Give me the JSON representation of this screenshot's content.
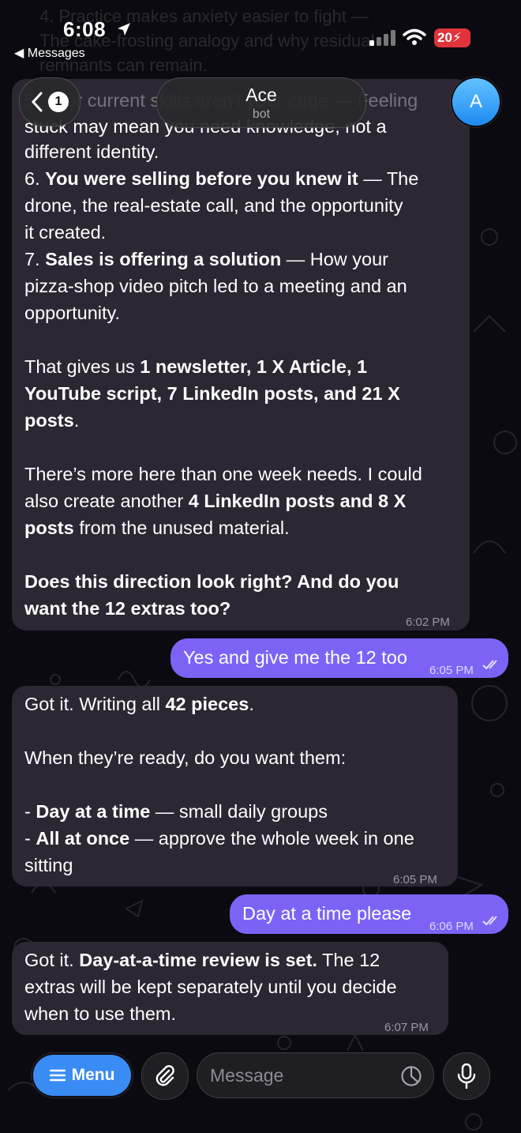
{
  "status": {
    "time": "6:08",
    "back_app": "◀ Messages",
    "battery": "20"
  },
  "header": {
    "unread": "1",
    "name": "Ace",
    "subtitle": "bot",
    "avatar_letter": "A"
  },
  "faded_top": [
    "4. Practice makes anxiety easier to fight —",
    "The cake-frosting analogy and why residual",
    "remnants can remain."
  ],
  "messages": {
    "m1": {
      "line_top": "5. Your current skills aren't your cage — Feeling",
      "line_clip": "stuck may mean you need knowledge, not a",
      "l1": "different identity.",
      "l2a": "6. ",
      "l2b": "You were selling before you knew it",
      "l2c": " — The",
      "l3": "drone, the real-estate call, and the opportunity",
      "l4": "it created.",
      "l5a": "7. ",
      "l5b": "Sales is offering a solution",
      "l5c": " — How your",
      "l6": "pizza-shop video pitch led to a meeting and an",
      "l7": "opportunity.",
      "l8a": "That gives us ",
      "l8b": "1 newsletter, 1 X Article, 1",
      "l9": "YouTube script, 7 LinkedIn posts, and 21 X",
      "l10a": "posts",
      "l10b": ".",
      "l11": "There’s more here than one week needs. I could",
      "l12a": "also create another ",
      "l12b": "4 LinkedIn posts and 8 X",
      "l13a": "posts",
      "l13b": " from the unused material.",
      "l14": "Does this direction look right? And do you",
      "l15": "want the 12 extras too?",
      "time": "6:02 PM"
    },
    "m2": {
      "text": "Yes and give me the 12 too",
      "time": "6:05 PM"
    },
    "m3": {
      "l1a": "Got it. Writing all ",
      "l1b": "42 pieces",
      "l1c": ".",
      "l2": "When they’re ready, do you want them:",
      "l3a": "- ",
      "l3b": "Day at a time",
      "l3c": " — small daily groups",
      "l4a": "- ",
      "l4b": "All at once",
      "l4c": " — approve the whole week in one",
      "l5": "sitting",
      "time": "6:05 PM"
    },
    "m4": {
      "text": "Day at a time please",
      "time": "6:06 PM"
    },
    "m5": {
      "l1a": "Got it. ",
      "l1b": "Day-at-a-time review is set.",
      "l1c": " The 12",
      "l2": "extras will be kept separately until you decide",
      "l3": "when to use them.",
      "time": "6:07 PM"
    }
  },
  "input": {
    "menu_label": "Menu",
    "placeholder": "Message"
  },
  "colors": {
    "accent": "#3a8cf5",
    "outgoing": "#7c63f6",
    "incoming": "#2c2732",
    "background": "#0b0a10"
  },
  "icons": [
    "location-arrow-icon",
    "signal-icon",
    "wifi-icon",
    "battery-icon",
    "chevron-left-icon",
    "menu-icon",
    "paperclip-icon",
    "sticker-icon",
    "microphone-icon",
    "double-check-icon"
  ]
}
